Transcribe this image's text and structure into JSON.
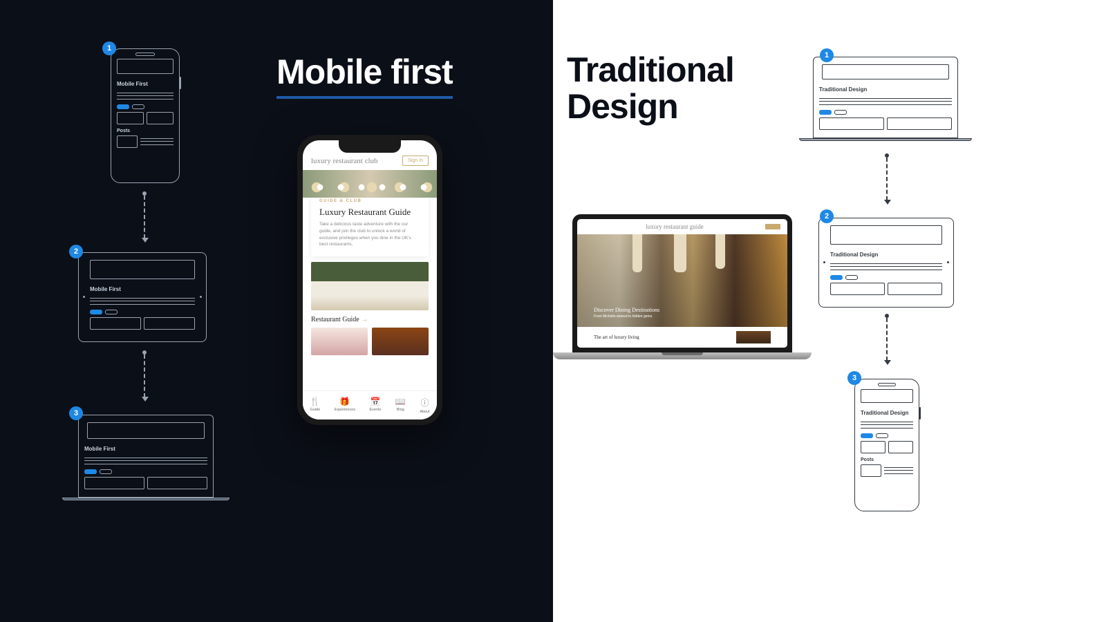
{
  "left": {
    "heading": "Mobile first",
    "step1_label": "1",
    "step2_label": "2",
    "step3_label": "3",
    "wire_label": "Mobile First",
    "wire_posts": "Posts",
    "phone": {
      "logo": "luxury restaurant club",
      "signin": "Sign In",
      "tag": "GUIDE & CLUB",
      "title": "Luxury Restaurant Guide",
      "para": "Take a delicious taste adventure with the our guide, and join the club to unlock a world of exclusive privileges when you dine in the UK's best restaurants.",
      "subtitle": "Restaurant Guide",
      "arrow": "→",
      "nav": {
        "guide": "Guide",
        "experiences": "Experiences",
        "events": "Events",
        "blog": "Blog",
        "about": "About"
      }
    }
  },
  "right": {
    "heading_line1": "Traditional",
    "heading_line2": "Design",
    "step1_label": "1",
    "step2_label": "2",
    "step3_label": "3",
    "wire_label": "Traditional Design",
    "wire_posts": "Posts",
    "laptop": {
      "logo": "luxury restaurant guide",
      "hero_title": "Discover Dining Destinations",
      "hero_sub": "From Michelin-starred to hidden gems",
      "footer_title": "The art of luxury living"
    }
  }
}
